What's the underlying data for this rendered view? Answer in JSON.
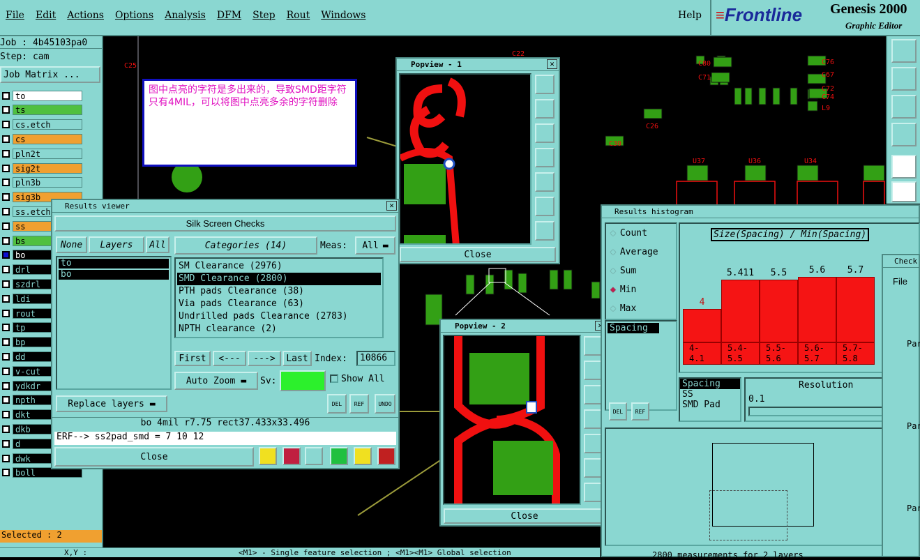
{
  "menubar": {
    "items": [
      "File",
      "Edit",
      "Actions",
      "Options",
      "Analysis",
      "DFM",
      "Step",
      "Rout",
      "Windows"
    ],
    "help": "Help"
  },
  "brand": {
    "logo": "Frontline",
    "product": "Genesis 2000",
    "subtitle": "Graphic Editor"
  },
  "job": {
    "job_label": "Job : 4b45103pa0",
    "step_label": "Step: cam",
    "matrix_button": "Job Matrix ..."
  },
  "layers": [
    "to",
    "ts",
    "cs.etch",
    "cs",
    "pln2t",
    "sig2t",
    "pln3b",
    "sig3b",
    "ss.etch",
    "ss",
    "bs",
    "bo",
    "drl",
    "szdrl",
    "ldi",
    "rout",
    "tp",
    "bp",
    "dd",
    "v-cut",
    "ydkdr",
    "npth",
    "dkt",
    "dkb",
    "d",
    "dwk",
    "boll"
  ],
  "selected_label": "Selected : 2",
  "note": {
    "text": "图中点亮的字符是多出来的，导致SMD距字符只有4MIL，可以将图中点亮多余的字符删除"
  },
  "results_viewer": {
    "title": "Results viewer",
    "header": "Silk Screen Checks",
    "none_btn": "None",
    "layers_btn": "Layers",
    "all_btn": "All",
    "layer_list": [
      "to",
      "bo"
    ],
    "categories_label": "Categories (14)",
    "meas_label": "Meas:",
    "meas_value": "All",
    "categories": [
      "SM Clearance (2976)",
      "SMD Clearance (2800)",
      "PTH pads Clearance (38)",
      "Via pads Clearance (63)",
      "Undrilled pads Clearance (2783)",
      "NPTH clearance (2)"
    ],
    "first": "First",
    "prev": "<---",
    "next": "--->",
    "last": "Last",
    "index_label": "Index:",
    "index_value": "10866",
    "auto_zoom": "Auto Zoom",
    "sv_label": "Sv:",
    "show_all": "Show All",
    "replace_layers": "Replace layers",
    "del": "DEL",
    "ref": "REF",
    "undo": "UNDO",
    "status": "bo 4mil  r7.75  rect37.433x33.496",
    "erf": "ERF--> ss2pad_smd = 7 10 12",
    "close": "Close"
  },
  "popview1": {
    "title": "Popview - 1",
    "close": "Close",
    "silk_text": "CS2"
  },
  "popview2": {
    "title": "Popview - 2",
    "close": "Close"
  },
  "histogram": {
    "title": "Results histogram",
    "options": [
      "Count",
      "Average",
      "Sum",
      "Min",
      "Max"
    ],
    "selected_option": "Min",
    "header": "Size(Spacing) / Min(Spacing)",
    "list_item": "Spacing",
    "bars_top": [
      "4",
      "5.411",
      "5.5",
      "5.6",
      "5.7"
    ],
    "bins": [
      [
        "4-",
        "4.1"
      ],
      [
        "5.4-",
        "5.5"
      ],
      [
        "5.5-",
        "5.6"
      ],
      [
        "5.6-",
        "5.7"
      ],
      [
        "5.7-",
        "5.8"
      ]
    ],
    "bar_levels": [
      0.4,
      0.75,
      0.75,
      0.78,
      0.78
    ],
    "info_lines": [
      "Spacing",
      "SS",
      "SMD Pad"
    ],
    "resolution_label": "Resolution",
    "resolution_value": "0.1",
    "del": "DEL",
    "ref": "REF",
    "footer": "2800 measurements for 2 layers"
  },
  "check_panel": {
    "title": "Check",
    "file": "File",
    "param": "Param"
  },
  "bottom": {
    "xy": "X,Y :",
    "hint": "<M1> - Single feature selection ; <M1><M1> Global selection"
  },
  "pcb_labels": [
    "C80",
    "C71",
    "C76",
    "C67",
    "C72",
    "C74",
    "L9",
    "C25",
    "C26",
    "C30",
    "C18",
    "C29",
    "C19",
    "C17",
    "C16",
    "C28",
    "R",
    "U37",
    "U36",
    "U34",
    "C"
  ]
}
